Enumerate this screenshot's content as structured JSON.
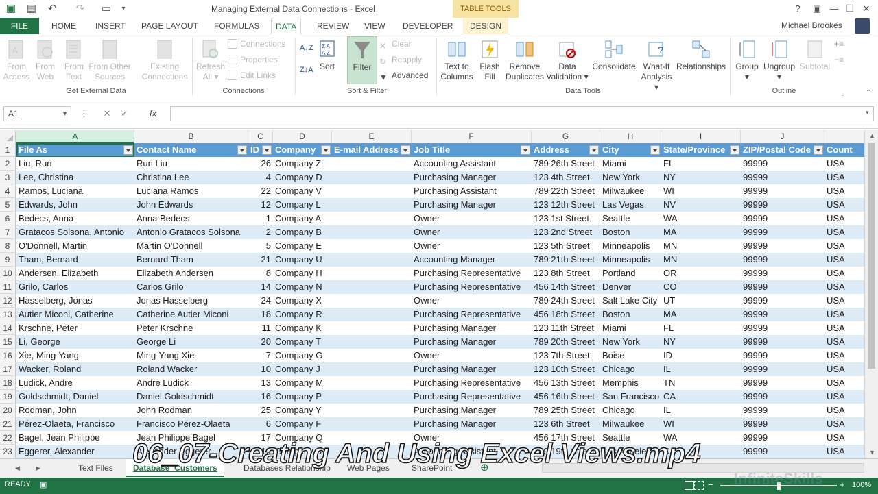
{
  "window": {
    "title": "Managing External Data Connections - Excel",
    "contextual_tab_group": "TABLE TOOLS",
    "user": "Michael Brookes"
  },
  "ribbon_tabs": [
    "HOME",
    "INSERT",
    "PAGE LAYOUT",
    "FORMULAS",
    "DATA",
    "REVIEW",
    "VIEW",
    "DEVELOPER"
  ],
  "file_tab": "FILE",
  "design_tab": "DESIGN",
  "ribbon": {
    "get_external_data": {
      "group": "Get External Data",
      "from_access": [
        "From",
        "Access"
      ],
      "from_web": [
        "From",
        "Web"
      ],
      "from_text": [
        "From",
        "Text"
      ],
      "from_other": [
        "From Other",
        "Sources"
      ],
      "existing": [
        "Existing",
        "Connections"
      ]
    },
    "connections": {
      "group": "Connections",
      "refresh": [
        "Refresh",
        "All"
      ],
      "connections": "Connections",
      "properties": "Properties",
      "edit_links": "Edit Links"
    },
    "sort_filter": {
      "group": "Sort & Filter",
      "sort": "Sort",
      "filter": "Filter",
      "clear": "Clear",
      "reapply": "Reapply",
      "advanced": "Advanced"
    },
    "data_tools": {
      "group": "Data Tools",
      "text_to_columns": [
        "Text to",
        "Columns"
      ],
      "flash_fill": [
        "Flash",
        "Fill"
      ],
      "remove_duplicates": [
        "Remove",
        "Duplicates"
      ],
      "data_validation": [
        "Data",
        "Validation"
      ],
      "consolidate": "Consolidate",
      "what_if": [
        "What-If",
        "Analysis"
      ],
      "relationships": "Relationships"
    },
    "outline": {
      "group": "Outline",
      "group_btn": "Group",
      "ungroup": "Ungroup",
      "subtotal": "Subtotal"
    }
  },
  "formula_bar": {
    "name_box": "A1",
    "fx": "fx",
    "value": ""
  },
  "columns": [
    "A",
    "B",
    "C",
    "D",
    "E",
    "F",
    "G",
    "H",
    "I",
    "J"
  ],
  "table": {
    "headers": [
      "File As",
      "Contact Name",
      "ID",
      "Company",
      "E-mail Address",
      "Job Title",
      "Address",
      "City",
      "State/Province",
      "ZIP/Postal Code",
      "Country/"
    ],
    "rows": [
      [
        "Liu, Run",
        "Run Liu",
        "26",
        "Company Z",
        "",
        "Accounting Assistant",
        "789 26th Street",
        "Miami",
        "FL",
        "99999",
        "USA"
      ],
      [
        "Lee, Christina",
        "Christina Lee",
        "4",
        "Company D",
        "",
        "Purchasing Manager",
        "123 4th Street",
        "New York",
        "NY",
        "99999",
        "USA"
      ],
      [
        "Ramos, Luciana",
        "Luciana Ramos",
        "22",
        "Company V",
        "",
        "Purchasing Assistant",
        "789 22th Street",
        "Milwaukee",
        "WI",
        "99999",
        "USA"
      ],
      [
        "Edwards, John",
        "John Edwards",
        "12",
        "Company L",
        "",
        "Purchasing Manager",
        "123 12th Street",
        "Las Vegas",
        "NV",
        "99999",
        "USA"
      ],
      [
        "Bedecs, Anna",
        "Anna Bedecs",
        "1",
        "Company A",
        "",
        "Owner",
        "123 1st Street",
        "Seattle",
        "WA",
        "99999",
        "USA"
      ],
      [
        "Gratacos Solsona, Antonio",
        "Antonio Gratacos Solsona",
        "2",
        "Company B",
        "",
        "Owner",
        "123 2nd Street",
        "Boston",
        "MA",
        "99999",
        "USA"
      ],
      [
        "O'Donnell, Martin",
        "Martin O'Donnell",
        "5",
        "Company E",
        "",
        "Owner",
        "123 5th Street",
        "Minneapolis",
        "MN",
        "99999",
        "USA"
      ],
      [
        "Tham, Bernard",
        "Bernard Tham",
        "21",
        "Company U",
        "",
        "Accounting Manager",
        "789 21th Street",
        "Minneapolis",
        "MN",
        "99999",
        "USA"
      ],
      [
        "Andersen, Elizabeth",
        "Elizabeth Andersen",
        "8",
        "Company H",
        "",
        "Purchasing Representative",
        "123 8th Street",
        "Portland",
        "OR",
        "99999",
        "USA"
      ],
      [
        "Grilo, Carlos",
        "Carlos Grilo",
        "14",
        "Company N",
        "",
        "Purchasing Representative",
        "456 14th Street",
        "Denver",
        "CO",
        "99999",
        "USA"
      ],
      [
        "Hasselberg, Jonas",
        "Jonas Hasselberg",
        "24",
        "Company X",
        "",
        "Owner",
        "789 24th Street",
        "Salt Lake City",
        "UT",
        "99999",
        "USA"
      ],
      [
        "Autier Miconi, Catherine",
        "Catherine Autier Miconi",
        "18",
        "Company R",
        "",
        "Purchasing Representative",
        "456 18th Street",
        "Boston",
        "MA",
        "99999",
        "USA"
      ],
      [
        "Krschne, Peter",
        "Peter Krschne",
        "11",
        "Company K",
        "",
        "Purchasing Manager",
        "123 11th Street",
        "Miami",
        "FL",
        "99999",
        "USA"
      ],
      [
        "Li, George",
        "George Li",
        "20",
        "Company T",
        "",
        "Purchasing Manager",
        "789 20th Street",
        "New York",
        "NY",
        "99999",
        "USA"
      ],
      [
        "Xie, Ming-Yang",
        "Ming-Yang Xie",
        "7",
        "Company G",
        "",
        "Owner",
        "123 7th Street",
        "Boise",
        "ID",
        "99999",
        "USA"
      ],
      [
        "Wacker, Roland",
        "Roland Wacker",
        "10",
        "Company J",
        "",
        "Purchasing Manager",
        "123 10th Street",
        "Chicago",
        "IL",
        "99999",
        "USA"
      ],
      [
        "Ludick, Andre",
        "Andre Ludick",
        "13",
        "Company M",
        "",
        "Purchasing Representative",
        "456 13th Street",
        "Memphis",
        "TN",
        "99999",
        "USA"
      ],
      [
        "Goldschmidt, Daniel",
        "Daniel Goldschmidt",
        "16",
        "Company P",
        "",
        "Purchasing Representative",
        "456 16th Street",
        "San Francisco",
        "CA",
        "99999",
        "USA"
      ],
      [
        "Rodman, John",
        "John Rodman",
        "25",
        "Company Y",
        "",
        "Purchasing Manager",
        "789 25th Street",
        "Chicago",
        "IL",
        "99999",
        "USA"
      ],
      [
        "Pérez-Olaeta, Francisco",
        "Francisco Pérez-Olaeta",
        "6",
        "Company F",
        "",
        "Purchasing Manager",
        "123 6th Street",
        "Milwaukee",
        "WI",
        "99999",
        "USA"
      ],
      [
        "Bagel, Jean Philippe",
        "Jean Philippe Bagel",
        "17",
        "Company Q",
        "",
        "Owner",
        "456 17th Street",
        "Seattle",
        "WA",
        "99999",
        "USA"
      ],
      [
        "Eggerer, Alexander",
        "Alexander Eggerer",
        "19",
        "Company S",
        "",
        "Accounting Assistant",
        "789 19th Street",
        "Los Angeles",
        "CA",
        "99999",
        "USA"
      ]
    ]
  },
  "sheet_tabs": {
    "items": [
      "Text Files",
      "Database_Customers",
      "Databases Relationship",
      "Web Pages",
      "SharePoint"
    ]
  },
  "status": {
    "ready": "READY",
    "zoom": "100%"
  },
  "overlay": {
    "caption": "06_07-Creating And Using Excel Views.mp4",
    "watermark": "InfiniteSkills"
  },
  "colors": {
    "excel_green": "#217346",
    "table_header": "#5b9bd5",
    "band_row": "#ddebf7"
  }
}
